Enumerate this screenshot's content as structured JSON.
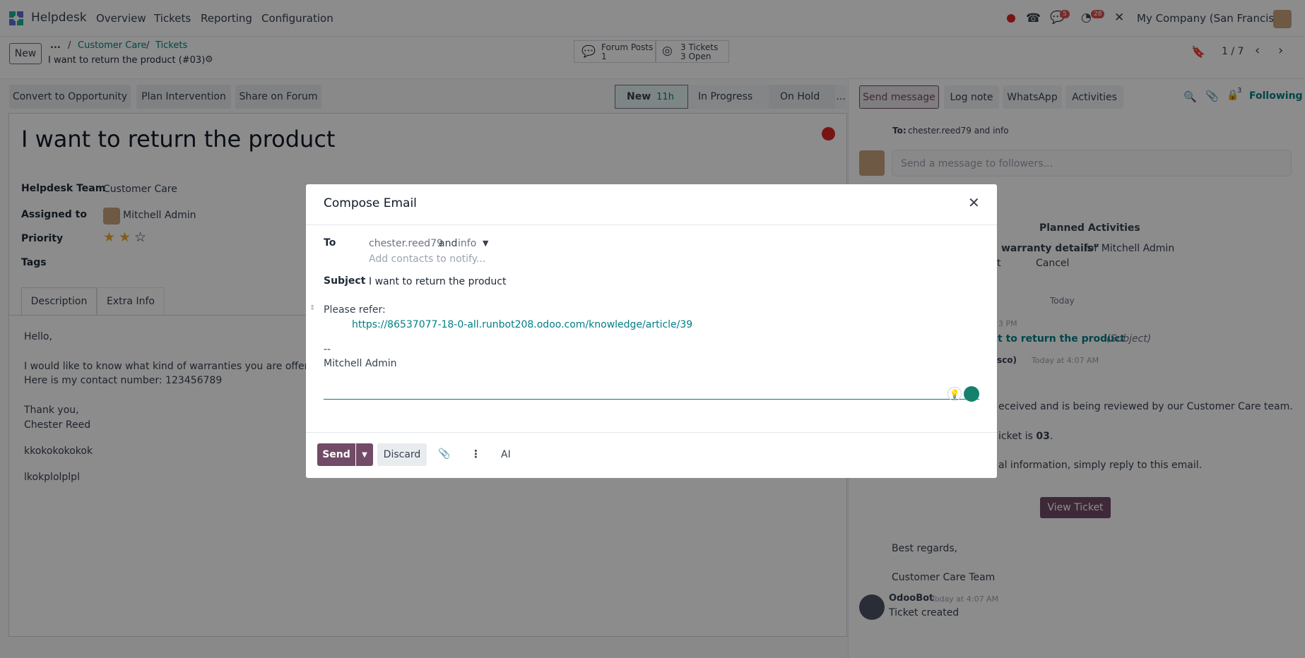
{
  "topnav": {
    "app_name": "Helpdesk",
    "menus": [
      "Overview",
      "Tickets",
      "Reporting",
      "Configuration"
    ],
    "messages_badge": "5",
    "activities_badge": "28",
    "company": "My Company (San Francisco)"
  },
  "control_panel": {
    "new_label": "New",
    "breadcrumb_ellipsis": "...",
    "breadcrumb_1": "Customer Care",
    "breadcrumb_2": "Tickets",
    "record_title": "I want to return the product (#03)",
    "smart_forum_label": "Forum Posts",
    "smart_forum_count": "1",
    "smart_tickets_label": "3 Tickets",
    "smart_tickets_open": "3 Open",
    "pager": "1 / 7"
  },
  "actions": {
    "convert": "Convert to Opportunity",
    "plan": "Plan Intervention",
    "share": "Share on Forum"
  },
  "stages": {
    "new": "New",
    "new_time": "11h",
    "in_progress": "In Progress",
    "on_hold": "On Hold",
    "more": "..."
  },
  "chatter_buttons": {
    "send_message": "Send message",
    "log_note": "Log note",
    "whatsapp": "WhatsApp",
    "activities": "Activities",
    "followers_count": "3",
    "following": "Following"
  },
  "form": {
    "title": "I want to return the product",
    "team_label": "Helpdesk Team",
    "team_value": "Customer Care",
    "assigned_label": "Assigned to",
    "assigned_value": "Mitchell Admin",
    "priority_label": "Priority",
    "priority_value": 2,
    "priority_max": 3,
    "tags_label": "Tags",
    "tab_description": "Description",
    "tab_extra": "Extra Info",
    "description": [
      "Hello,",
      "I would like to know what kind of warranties you are offering fo",
      "Here is my contact number: 123456789",
      "Thank you,",
      "Chester Reed",
      "kkokokokokok",
      "lkokplolplpl"
    ]
  },
  "chatter": {
    "to_label": "To:",
    "to_value": "chester.reed79 and info",
    "composer_placeholder": "Send a message to followers...",
    "planned_activities": "Planned Activities",
    "activity_text": "warranty details”",
    "activity_for": "for Mitchell Admin",
    "activity_t": "t",
    "activity_cancel": "Cancel",
    "today_label": "Today",
    "time_fragment": "3 PM",
    "msg_subject": "t to return the product",
    "msg_subject_tag": "(Subject)",
    "author_fragment": "sco)",
    "msg_time": "Today at 4:07 AM",
    "body_line1": "eceived and is being reviewed by our Customer Care team.",
    "body_line2_pre": "icket is ",
    "body_line2_num": "03",
    "body_line3": "al information, simply reply to this email.",
    "view_ticket": "View Ticket",
    "best_regards": "Best regards,",
    "signature": "Customer Care Team",
    "bot_name": "OdooBot",
    "bot_time": "Today at 4:07 AM",
    "bot_msg": "Ticket created"
  },
  "modal": {
    "title": "Compose Email",
    "to_label": "To",
    "to_recipient1": "chester.reed79",
    "to_and": "and",
    "to_recipient2": "info",
    "add_contacts_placeholder": "Add contacts to notify...",
    "subject_label": "Subject",
    "subject_value": "I want to return the product",
    "body_line1": "Please refer:",
    "body_link": "https://86537077-18-0-all.runbot208.odoo.com/knowledge/article/39",
    "body_sep": "--",
    "body_sig": "Mitchell Admin",
    "send": "Send",
    "discard": "Discard",
    "ai": "AI"
  },
  "colors": {
    "primary": "#714b67",
    "link": "#017e84",
    "badge_red": "#d9534f"
  }
}
